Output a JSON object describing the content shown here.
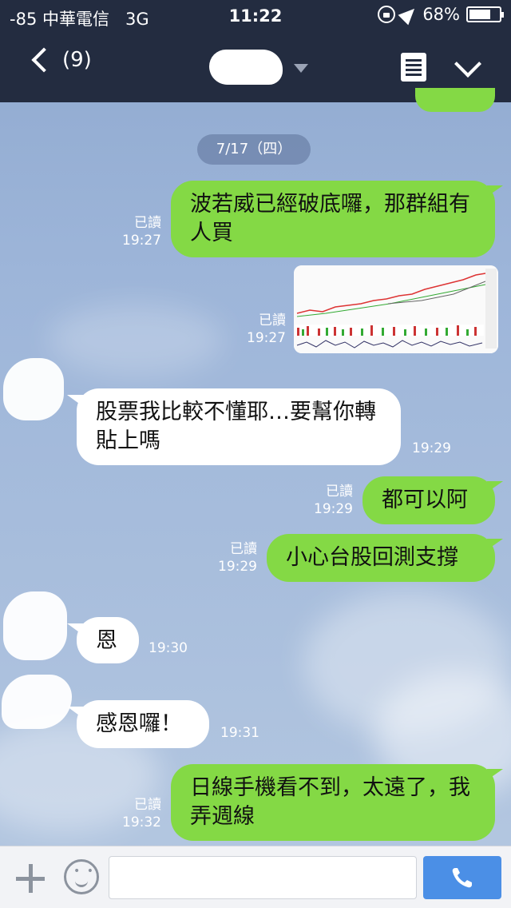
{
  "status_bar": {
    "signal": "-85",
    "carrier": "中華電信",
    "network": "3G",
    "time": "11:22",
    "battery": "68%",
    "battery_level": 0.68
  },
  "nav": {
    "unread_count": "(9)"
  },
  "date_divider": "7/17（四）",
  "messages": [
    {
      "side": "out",
      "type": "text",
      "text": "波若威已經破底囉，那群組有人買",
      "read": "已讀",
      "time": "19:27"
    },
    {
      "side": "out",
      "type": "image",
      "read": "已讀",
      "time": "19:27"
    },
    {
      "side": "in",
      "type": "text",
      "text": "股票我比較不懂耶…要幫你轉貼上嗎",
      "time": "19:29"
    },
    {
      "side": "out",
      "type": "text",
      "text": "都可以阿",
      "read": "已讀",
      "time": "19:29"
    },
    {
      "side": "out",
      "type": "text",
      "text": "小心台股回測支撐",
      "read": "已讀",
      "time": "19:29"
    },
    {
      "side": "in",
      "type": "text",
      "text": "恩",
      "time": "19:30"
    },
    {
      "side": "in",
      "type": "text",
      "text": "感恩囉！",
      "time": "19:31"
    },
    {
      "side": "out",
      "type": "text",
      "text": "日線手機看不到，太遠了，我弄週線",
      "read": "已讀",
      "time": "19:32"
    }
  ],
  "input": {
    "placeholder": ""
  },
  "icons": [
    "back-icon",
    "caret-down-icon",
    "notes-icon",
    "chevron-down-icon",
    "plus-icon",
    "emoji-icon",
    "phone-icon"
  ],
  "colors": {
    "nav_bg": "#232c40",
    "out_bubble": "#84d945",
    "in_bubble": "#ffffff",
    "call_button": "#4b8fe6"
  }
}
